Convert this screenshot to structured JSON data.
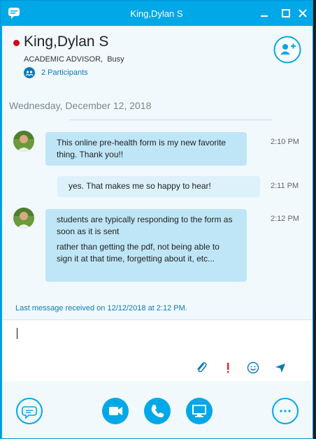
{
  "window": {
    "title": "King,Dylan S"
  },
  "contact": {
    "name": "King,Dylan S",
    "title": "ACADEMIC ADVISOR",
    "status": "Busy",
    "participants": "2 Participants"
  },
  "conversation": {
    "date": "Wednesday, December 12, 2018",
    "messages": [
      {
        "direction": "in",
        "lines": [
          "This online pre-health form is my new favorite thing. Thank you!!"
        ],
        "time": "2:10 PM"
      },
      {
        "direction": "out",
        "lines": [
          "yes. That makes me so happy to hear!"
        ],
        "time": "2:11 PM"
      },
      {
        "direction": "in",
        "lines": [
          "students are typically responding to the form as soon as it is sent",
          "rather than getting the pdf, not being able to sign it at that time, forgetting about it, etc..."
        ],
        "time": "2:12 PM"
      }
    ],
    "last_received": "Last message received on 12/12/2018 at 2:12 PM."
  },
  "colors": {
    "accent": "#00a8e8",
    "busy": "#d0021b",
    "important": "#e02424"
  },
  "icons": {
    "titlebar": [
      "chat-bubble-icon",
      "minimize-icon",
      "maximize-icon",
      "close-icon"
    ],
    "input_tools": [
      "paperclip-icon",
      "important-icon",
      "emoji-icon",
      "send-icon"
    ],
    "bottom": [
      "chat-icon",
      "video-icon",
      "phone-icon",
      "screen-share-icon",
      "more-icon"
    ]
  }
}
